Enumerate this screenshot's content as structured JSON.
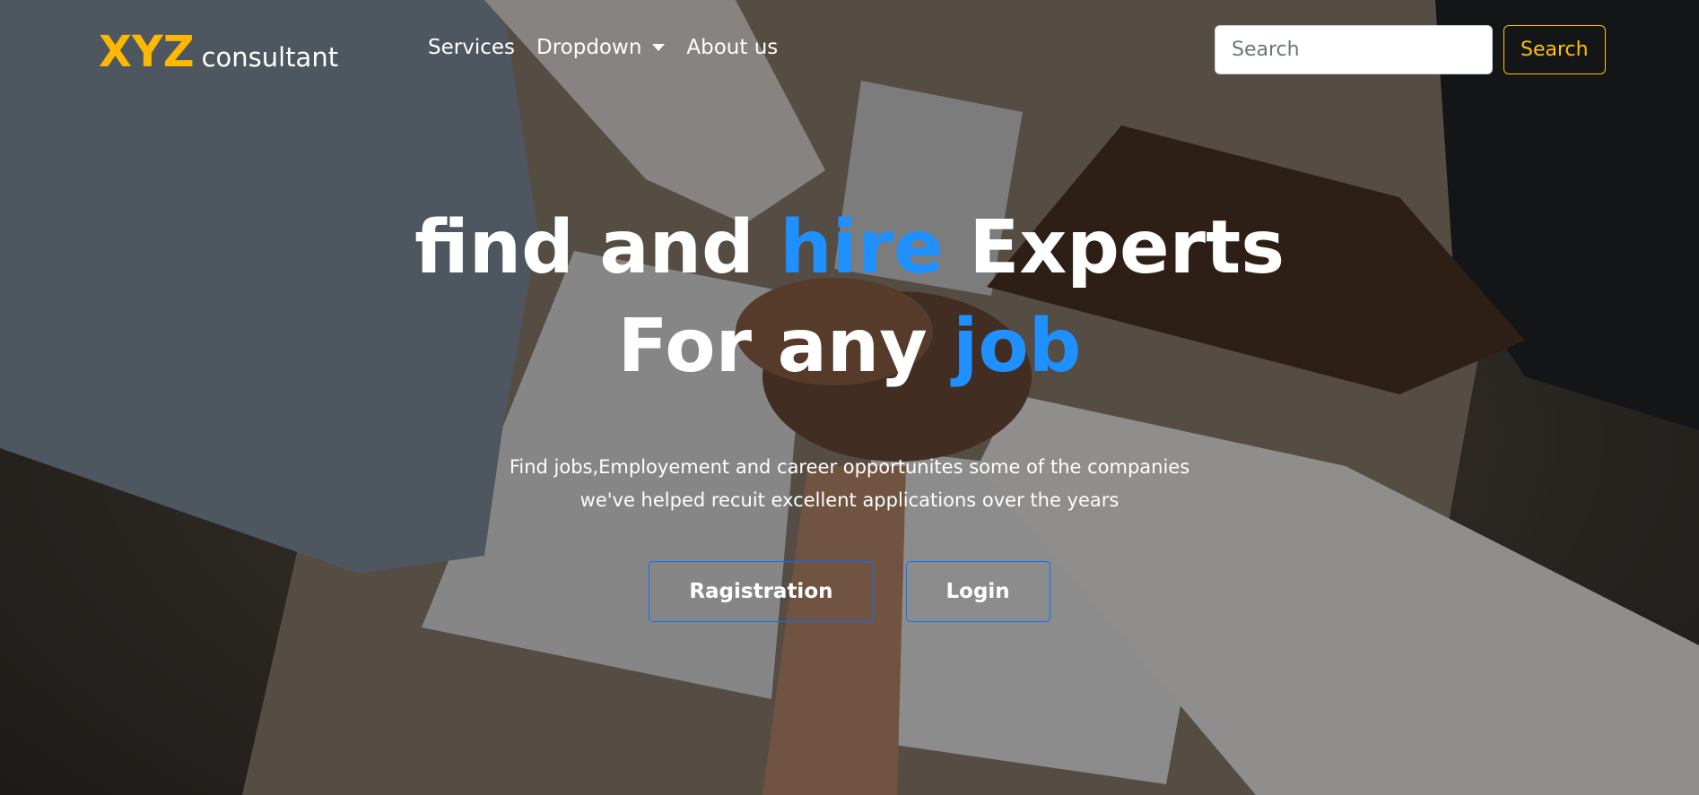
{
  "brand": {
    "primary": "XYZ",
    "secondary": "consultant"
  },
  "nav": {
    "items": [
      {
        "label": "Services"
      },
      {
        "label": "Dropdown"
      },
      {
        "label": "About us"
      }
    ]
  },
  "search": {
    "placeholder": "Search",
    "button_label": "Search"
  },
  "hero": {
    "line1_a": "find and ",
    "line1_accent": "hire",
    "line1_b": " Experts",
    "line2_a": "For any ",
    "line2_accent": "job",
    "subtext_line1": "Find jobs,Employement and career opportunites some of the companies",
    "subtext_line2": "we've helped recuit excellent applications over the years"
  },
  "actions": {
    "register_label": "Ragistration",
    "login_label": "Login"
  },
  "colors": {
    "brand": "#ffb800",
    "accent": "#1e90ff",
    "search_outline": "#ffc107",
    "cta_border": "#0d6efd"
  },
  "icons": {
    "dropdown": "caret-down-icon",
    "background": "team-hands-photo"
  }
}
